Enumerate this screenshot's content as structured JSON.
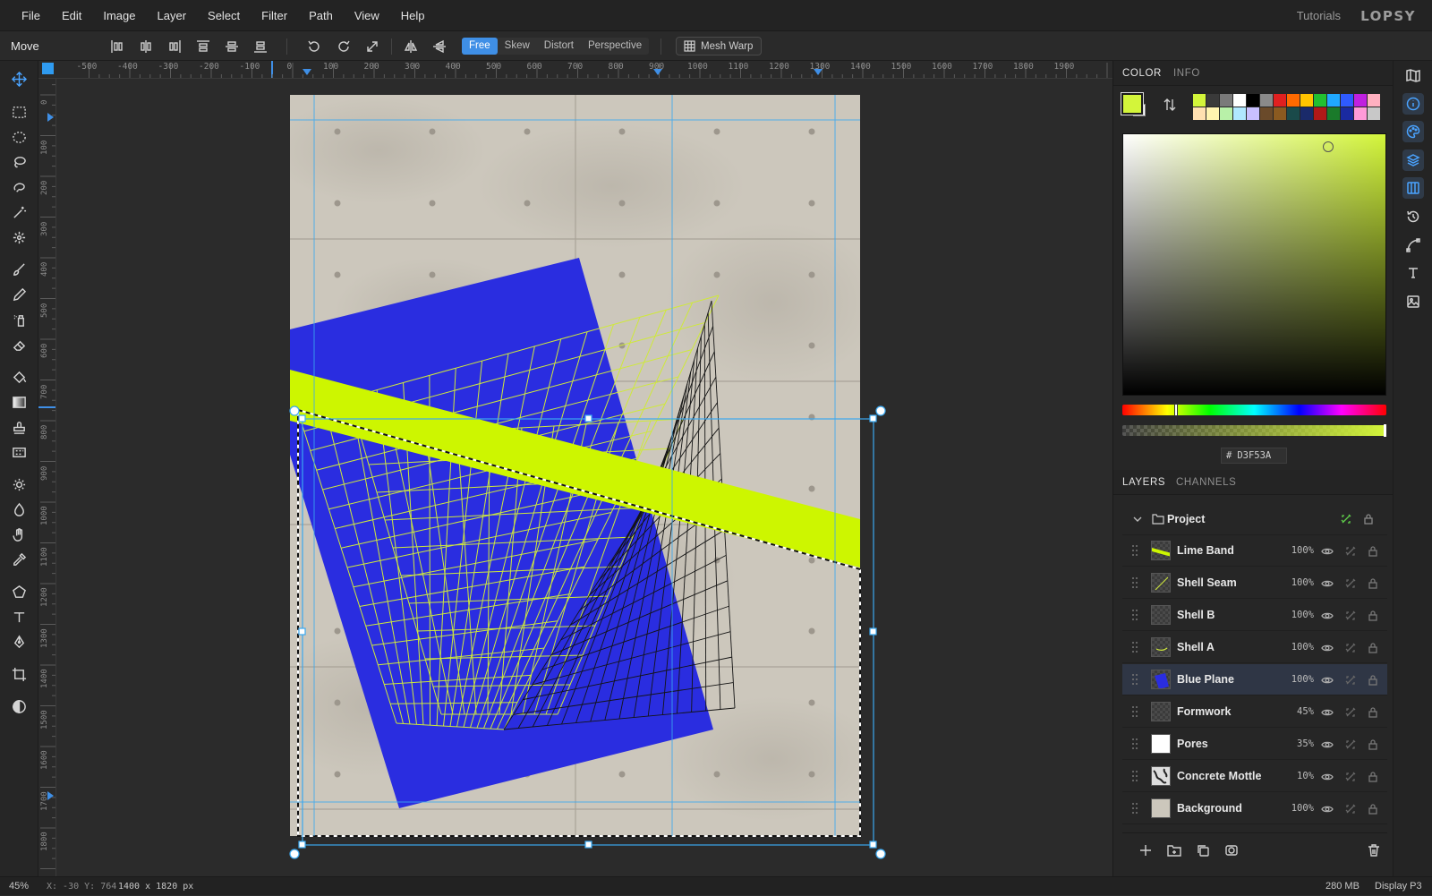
{
  "menubar": {
    "items": [
      "File",
      "Edit",
      "Image",
      "Layer",
      "Select",
      "Filter",
      "Path",
      "View",
      "Help"
    ],
    "tutorials": "Tutorials",
    "logo": "LOPSY"
  },
  "options": {
    "tool_name": "Move",
    "transform_modes": [
      "Free",
      "Skew",
      "Distort",
      "Perspective"
    ],
    "active_mode": "Free",
    "mesh_warp": "Mesh Warp"
  },
  "ruler": {
    "top_labels": [
      "-500",
      "-400",
      "-300",
      "-200",
      "-100",
      "0",
      "100",
      "200",
      "300",
      "400",
      "500",
      "600",
      "700",
      "800",
      "900",
      "1000",
      "1100",
      "1200",
      "1300",
      "1400",
      "1500",
      "1600",
      "1700",
      "1800",
      "1900"
    ],
    "left_labels": [
      "0",
      "100",
      "200",
      "300",
      "400",
      "500",
      "600",
      "700",
      "800",
      "900",
      "1000",
      "1100",
      "1200",
      "1300",
      "1400",
      "1500",
      "1600",
      "1700",
      "1800"
    ]
  },
  "color_panel": {
    "tabs": [
      "COLOR",
      "INFO"
    ],
    "foreground": "#D3F53A",
    "background": "#FFFFFF",
    "hex_prefix": "#",
    "hex_value": "D3F53A",
    "swatches_row1": [
      "#d3f53a",
      "#3a3a3a",
      "#7a7a7a",
      "#ffffff",
      "#000000",
      "#8a8a8a",
      "#e02020",
      "#ff6a00",
      "#ffc400",
      "#22c030",
      "#20a8ff",
      "#2f5bff",
      "#c020e0",
      "#ffb0c0"
    ],
    "swatches_row2": [
      "#ffe0b0",
      "#fff4b0",
      "#b8f0a8",
      "#b0e8ff",
      "#c8c0ff",
      "#6a4a2a",
      "#8a5a20",
      "#1a4a4a",
      "#1a2a6a",
      "#b01818",
      "#1a7a2a",
      "#1a2aa0",
      "#ff9ad8",
      "#c8c8c8"
    ]
  },
  "layers_panel": {
    "tabs": [
      "LAYERS",
      "CHANNELS"
    ],
    "group": "Project",
    "layers": [
      {
        "name": "Lime Band",
        "opacity": "100%"
      },
      {
        "name": "Shell Seam",
        "opacity": "100%"
      },
      {
        "name": "Shell B",
        "opacity": "100%"
      },
      {
        "name": "Shell A",
        "opacity": "100%"
      },
      {
        "name": "Blue Plane",
        "opacity": "100%"
      },
      {
        "name": "Formwork",
        "opacity": "45%"
      },
      {
        "name": "Pores",
        "opacity": "35%"
      },
      {
        "name": "Concrete Mottle",
        "opacity": "10%"
      },
      {
        "name": "Background",
        "opacity": "100%"
      }
    ],
    "selected": "Blue Plane"
  },
  "canvas": {
    "accent_blue": "#2a2de0",
    "accent_lime": "#cdf600",
    "concrete": "#c8c3b8"
  },
  "status": {
    "zoom": "45%",
    "coords": "X: -30 Y: 764",
    "size": "1400 x 1820 px",
    "memory": "280 MB",
    "profile": "Display P3"
  }
}
